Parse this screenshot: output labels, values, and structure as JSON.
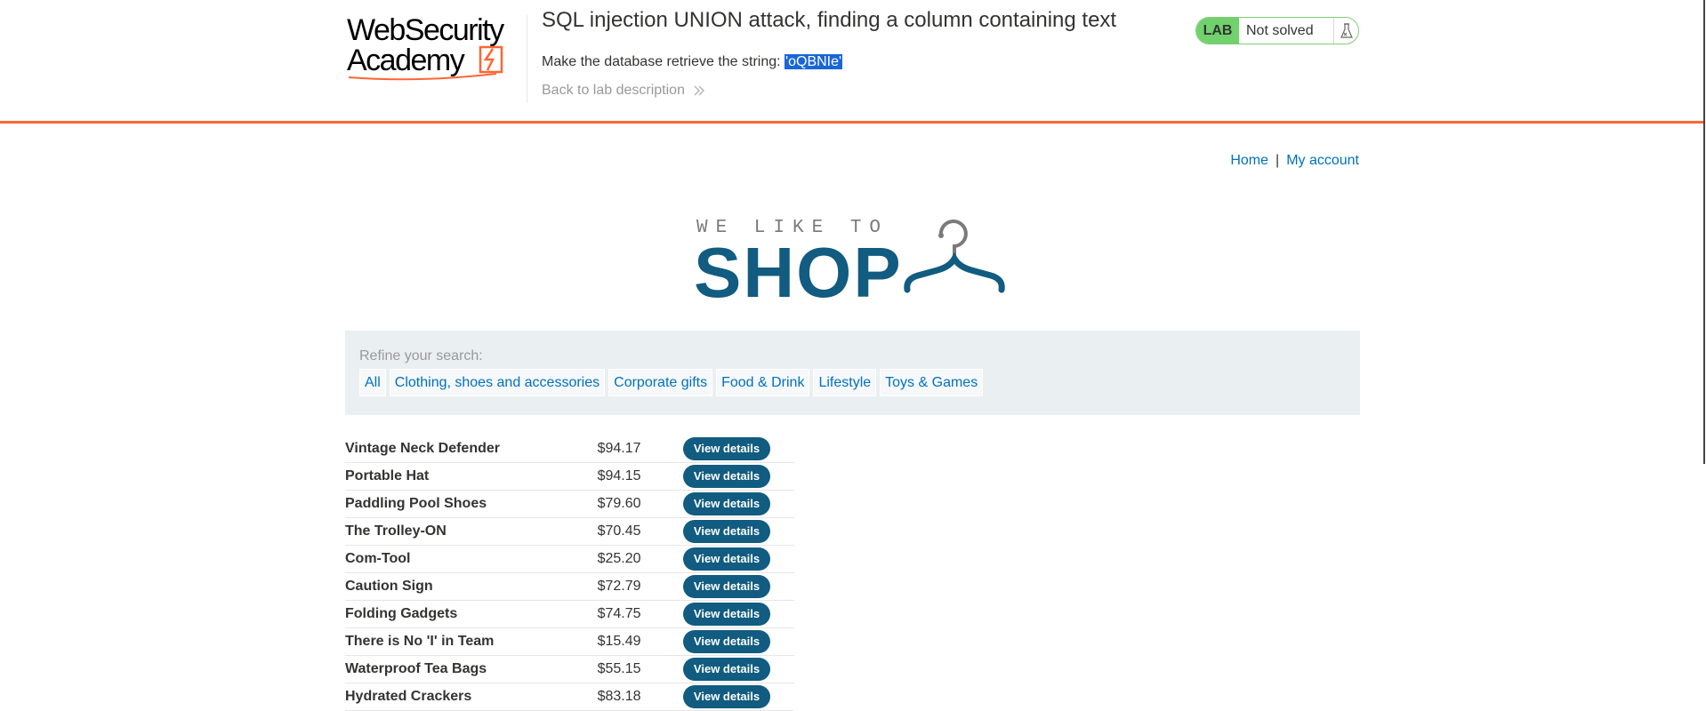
{
  "academy": {
    "logo_text_line1": "WebSecurity",
    "logo_text_line2": "Academy",
    "lab_title": "SQL injection UNION attack, finding a column containing text",
    "goal_prefix": "Make the database retrieve the string: ",
    "goal_string": "'oQBNIe'",
    "back_link": "Back to lab description",
    "lab_badge": "LAB",
    "lab_status": "Not solved",
    "accent_color": "#ff6633"
  },
  "nav": {
    "home": "Home",
    "separator": "|",
    "account": "My account"
  },
  "banner": {
    "line1": "WE LIKE TO",
    "line2": "SHOP"
  },
  "filters": {
    "label": "Refine your search:",
    "items": [
      "All",
      "Clothing, shoes and accessories",
      "Corporate gifts",
      "Food & Drink",
      "Lifestyle",
      "Toys & Games"
    ]
  },
  "products": [
    {
      "name": "Vintage Neck Defender",
      "price": "$94.17",
      "action": "View details"
    },
    {
      "name": "Portable Hat",
      "price": "$94.15",
      "action": "View details"
    },
    {
      "name": "Paddling Pool Shoes",
      "price": "$79.60",
      "action": "View details"
    },
    {
      "name": "The Trolley-ON",
      "price": "$70.45",
      "action": "View details"
    },
    {
      "name": "Com-Tool",
      "price": "$25.20",
      "action": "View details"
    },
    {
      "name": "Caution Sign",
      "price": "$72.79",
      "action": "View details"
    },
    {
      "name": "Folding Gadgets",
      "price": "$74.75",
      "action": "View details"
    },
    {
      "name": "There is No 'I' in Team",
      "price": "$15.49",
      "action": "View details"
    },
    {
      "name": "Waterproof Tea Bags",
      "price": "$55.15",
      "action": "View details"
    },
    {
      "name": "Hydrated Crackers",
      "price": "$83.18",
      "action": "View details"
    }
  ]
}
